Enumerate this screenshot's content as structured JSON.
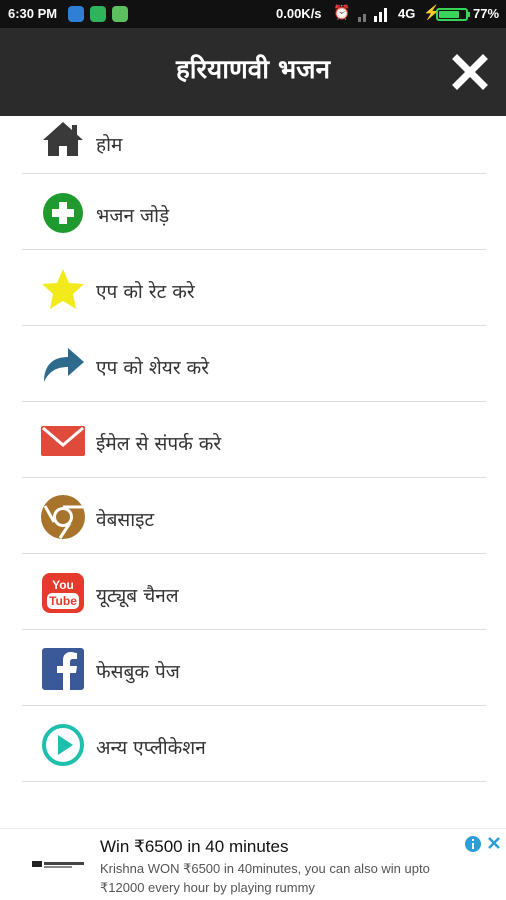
{
  "status_bar": {
    "time": "6:30 PM",
    "speed": "0.00K/s",
    "network": "4G",
    "battery_percent": "77%",
    "battery_level": 0.77,
    "icons": [
      "app-notification-icon",
      "whatsapp-icon",
      "app-icon",
      "alarm-icon",
      "signal-icon",
      "charging-icon"
    ]
  },
  "header": {
    "title": "हरियाणवी भजन",
    "close_icon": "close-icon"
  },
  "menu": {
    "items": [
      {
        "label": "होम",
        "icon": "home-icon",
        "color": "#3a3a3a"
      },
      {
        "label": "भजन जोड़े",
        "icon": "add-circle-icon",
        "color": "#1f9a2f"
      },
      {
        "label": "एप को रेट करे",
        "icon": "star-icon",
        "color": "#f2ea1a"
      },
      {
        "label": "एप को शेयर करे",
        "icon": "share-arrow-icon",
        "color": "#2d6a8c"
      },
      {
        "label": "ईमेल से संपर्क करे",
        "icon": "email-icon",
        "color": "#e04a3a"
      },
      {
        "label": "वेबसाइट",
        "icon": "chrome-icon",
        "color": "#a8742c"
      },
      {
        "label": "यूट्यूब चैनल",
        "icon": "youtube-icon",
        "color": "#e53a2c"
      },
      {
        "label": "फेसबुक पेज",
        "icon": "facebook-icon",
        "color": "#3b5998"
      },
      {
        "label": "अन्य एप्लीकेशन",
        "icon": "play-circle-icon",
        "color": "#1fbfae"
      }
    ]
  },
  "ad": {
    "title": "Win ₹6500 in 40 minutes",
    "text": "Krishna WON ₹6500 in 40minutes, you can also win upto ₹12000 every hour by playing rummy",
    "icons": [
      "ad-info-icon",
      "ad-close-icon"
    ]
  }
}
